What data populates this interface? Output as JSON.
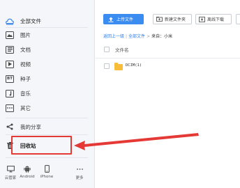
{
  "sidebar": {
    "items": [
      {
        "label": "全部文件",
        "icon": "cloud-icon"
      },
      {
        "label": "图片",
        "icon": "image-icon"
      },
      {
        "label": "文档",
        "icon": "document-icon"
      },
      {
        "label": "视频",
        "icon": "video-icon"
      },
      {
        "label": "种子",
        "icon": "bt-icon"
      },
      {
        "label": "音乐",
        "icon": "music-icon"
      },
      {
        "label": "其它",
        "icon": "more-icon"
      }
    ],
    "share_label": "我的分享",
    "trash_label": "回收站",
    "bt_glyph": "BT",
    "devices": [
      {
        "label": "云管家",
        "icon": "monitor-icon"
      },
      {
        "label": "Android",
        "icon": "android-icon"
      },
      {
        "label": "iPhone",
        "icon": "iphone-icon"
      },
      {
        "label": "更多",
        "icon": "ellipsis-icon"
      }
    ]
  },
  "toolbar": {
    "upload_label": "上传文件",
    "new_folder_label": "新建文件夹",
    "offline_download_label": "离线下载"
  },
  "breadcrumb": {
    "back_label": "返回上一级",
    "all_files_label": "全部文件",
    "current_prefix": "来自：",
    "current_label": "小米"
  },
  "file_list": {
    "header_label": "文件名",
    "rows": [
      {
        "name": "DCIM(1)",
        "type": "folder"
      }
    ]
  },
  "colors": {
    "accent": "#3b8cf0",
    "annotation": "#e53935",
    "folder": "#f7bd3a"
  }
}
